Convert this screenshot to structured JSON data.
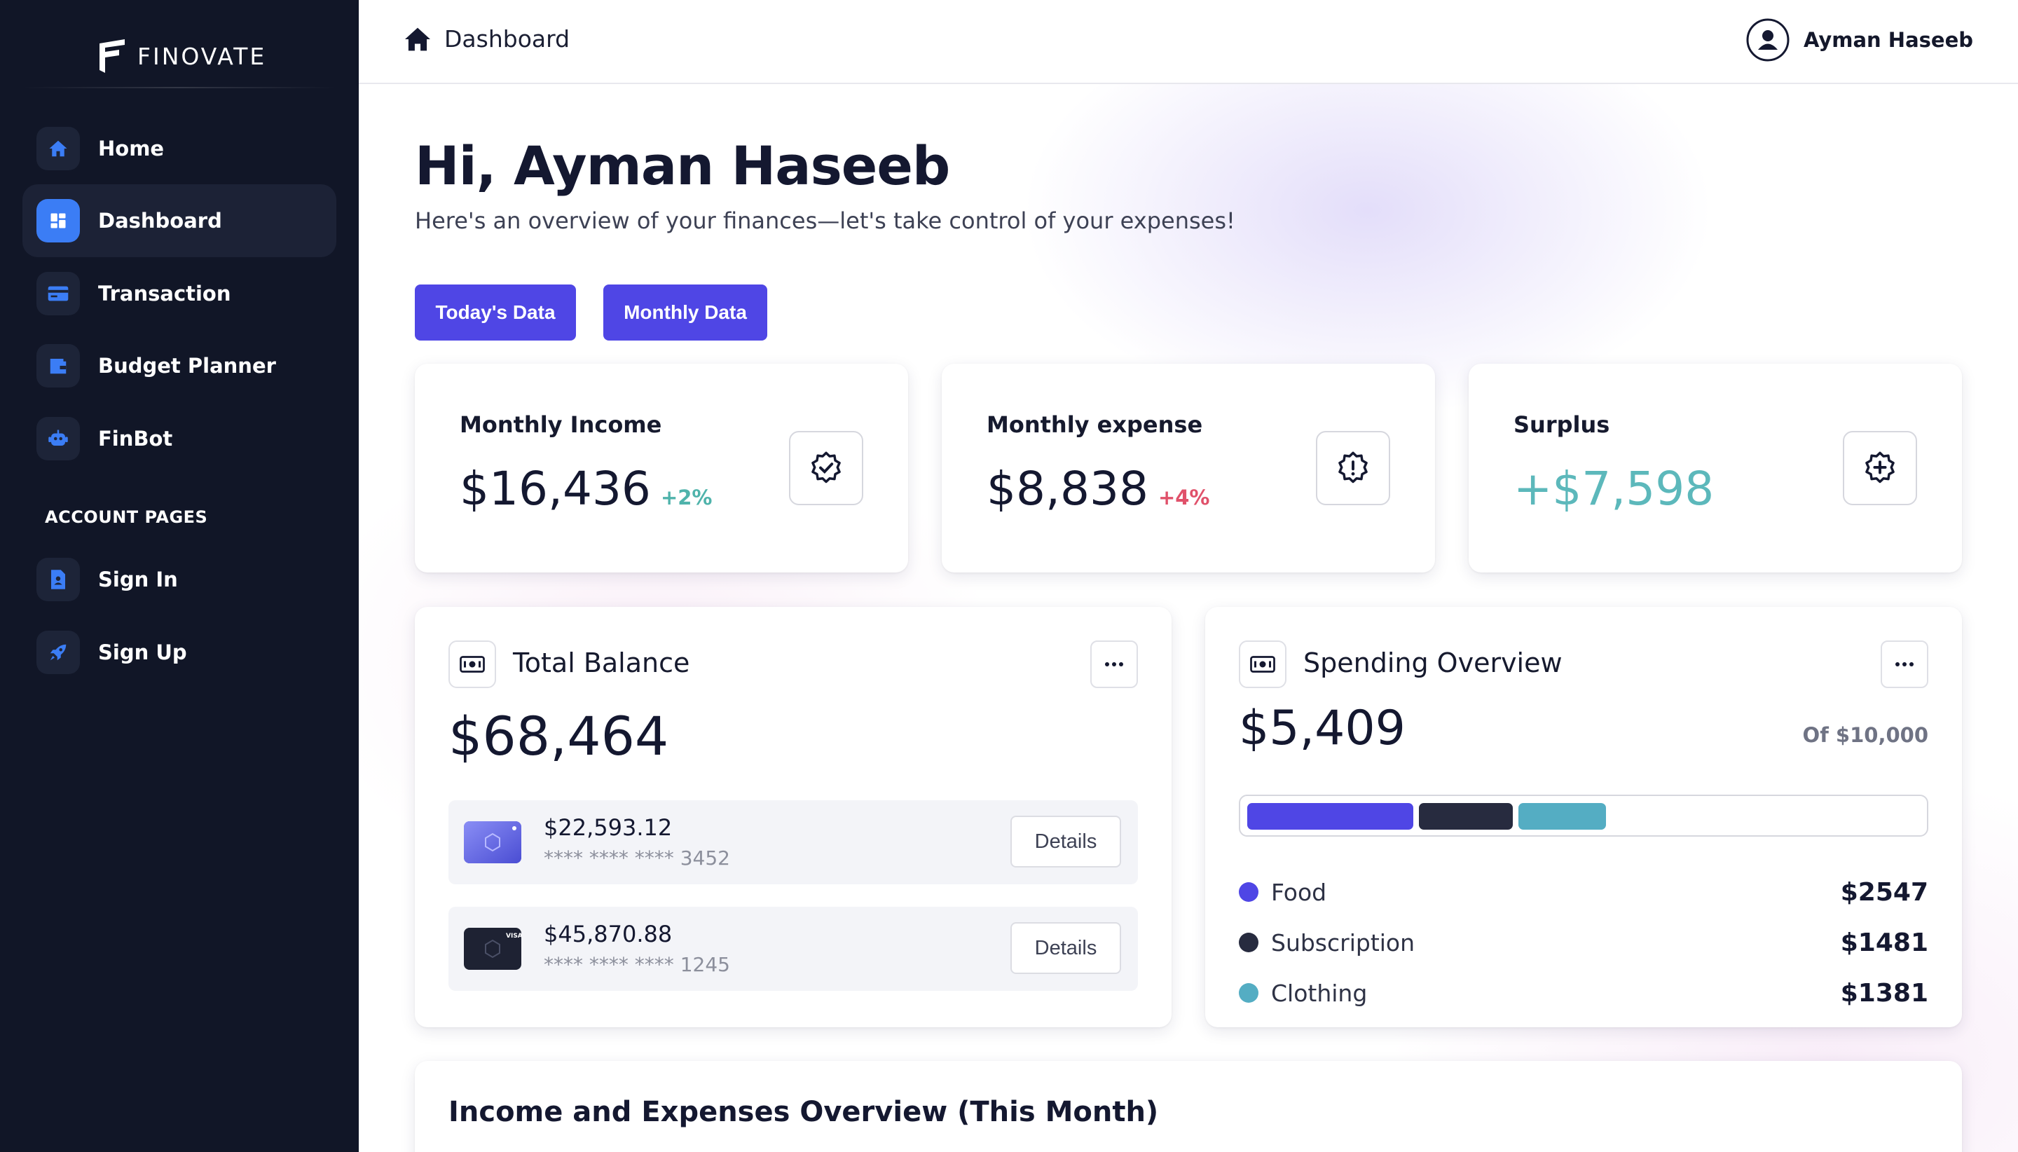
{
  "brand": {
    "name": "FINOVATE"
  },
  "sidebar": {
    "items": [
      {
        "label": "Home",
        "icon": "home-icon"
      },
      {
        "label": "Dashboard",
        "icon": "dashboard-icon",
        "active": true
      },
      {
        "label": "Transaction",
        "icon": "credit-card-icon"
      },
      {
        "label": "Budget Planner",
        "icon": "wallet-icon"
      },
      {
        "label": "FinBot",
        "icon": "robot-icon"
      }
    ],
    "section_label": "ACCOUNT PAGES",
    "account_items": [
      {
        "label": "Sign In",
        "icon": "document-icon"
      },
      {
        "label": "Sign Up",
        "icon": "rocket-icon"
      }
    ]
  },
  "header": {
    "breadcrumb": "Dashboard",
    "user_name": "Ayman Haseeb"
  },
  "main": {
    "greeting": "Hi, Ayman Haseeb",
    "subtitle": "Here's an overview of your finances—let's take control of your expenses!",
    "buttons": {
      "today": "Today's Data",
      "monthly": "Monthly Data"
    },
    "stats": [
      {
        "label": "Monthly Income",
        "value": "$16,436",
        "change": "+2%",
        "change_color": "#4fb3ab",
        "icon": "check-badge-icon"
      },
      {
        "label": "Monthly expense",
        "value": "$8,838",
        "change": "+4%",
        "change_color": "#e0516a",
        "icon": "alert-badge-icon"
      },
      {
        "label": "Surplus",
        "value": "+$7,598",
        "value_color": "#5cb8bb",
        "icon": "plus-badge-icon"
      }
    ],
    "total_balance": {
      "title": "Total Balance",
      "value": "$68,464",
      "accounts": [
        {
          "amount": "$22,593.12",
          "number": "**** **** **** 3452",
          "details": "Details",
          "card_color": "#5b5fe0"
        },
        {
          "amount": "$45,870.88",
          "number": "**** **** **** 1245",
          "details": "Details",
          "card_color": "#1e2233"
        }
      ]
    },
    "spending": {
      "title": "Spending Overview",
      "value": "$5,409",
      "of_label": "Of $10,000",
      "total": 10000,
      "categories": [
        {
          "label": "Food",
          "value": "$2547",
          "amount": 2547,
          "color": "#4f46e5"
        },
        {
          "label": "Subscription",
          "value": "$1481",
          "amount": 1481,
          "color": "#272b3f"
        },
        {
          "label": "Clothing",
          "value": "$1381",
          "amount": 1381,
          "color": "#54adc3"
        }
      ]
    },
    "overview_title": "Income and Expenses Overview (This Month)"
  },
  "colors": {
    "accent": "#4f46e5",
    "sidebar": "#111627",
    "active_icon": "#3b7df5"
  }
}
